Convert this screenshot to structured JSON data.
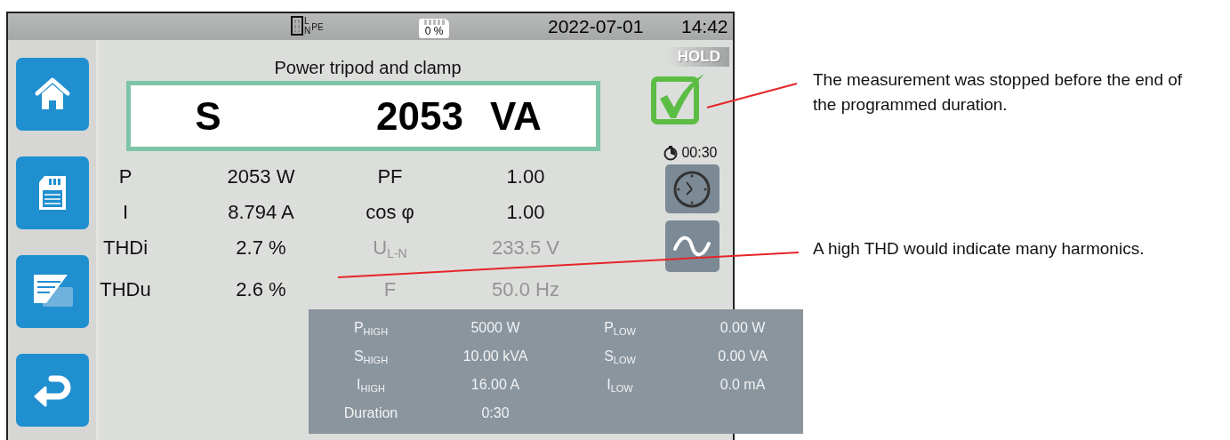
{
  "status_bar": {
    "wiring_labels": [
      "L",
      "N",
      "PE"
    ],
    "storage": "0 %",
    "date": "2022-07-01",
    "time": "14:42"
  },
  "title": "Power tripod and clamp",
  "hold_badge": "HOLD",
  "main_reading": {
    "symbol": "S",
    "value": "2053",
    "unit": "VA"
  },
  "completed": {
    "checked": true
  },
  "timer": "00:30",
  "measurements": [
    {
      "label": "P",
      "value": "2053 W",
      "disabled": false
    },
    {
      "label": "PF",
      "value": "1.00",
      "disabled": false
    },
    {
      "label": "I",
      "value": "8.794 A",
      "disabled": false
    },
    {
      "label": "cos φ",
      "value": "1.00",
      "disabled": false
    },
    {
      "label": "THDi",
      "value": "2.7 %",
      "disabled": false
    },
    {
      "label": "U$_{L-N}$",
      "value": "233.5 V",
      "disabled": true
    },
    {
      "label": "THDu",
      "value": "2.6 %",
      "disabled": false
    },
    {
      "label": "F",
      "value": "50.0 Hz",
      "disabled": true
    }
  ],
  "limits": [
    {
      "label": "P$_{HIGH}$",
      "value": "5000 W"
    },
    {
      "label": "P$_{LOW}$",
      "value": "0.00 W"
    },
    {
      "label": "S$_{HIGH}$",
      "value": "10.00 kVA"
    },
    {
      "label": "S$_{LOW}$",
      "value": "0.00 VA"
    },
    {
      "label": "I$_{HIGH}$",
      "value": "16.00 A"
    },
    {
      "label": "I$_{LOW}$",
      "value": "0.0 mA"
    },
    {
      "label": "Duration",
      "value": "0:30"
    }
  ],
  "annotations": [
    "The measurement was stopped before the end of the programmed duration.",
    "A high THD would indicate many harmonics."
  ]
}
